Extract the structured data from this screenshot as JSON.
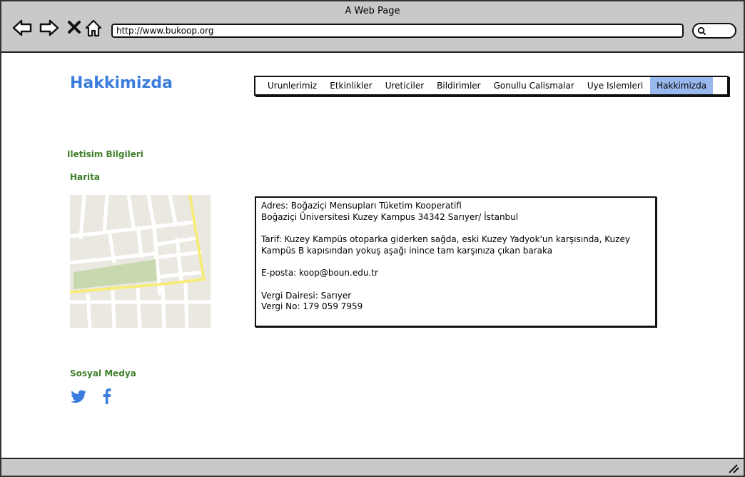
{
  "browser": {
    "window_title": "A Web Page",
    "url": "http://www.bukoop.org"
  },
  "page": {
    "title": "Hakkimizda"
  },
  "nav": {
    "items": [
      "Urunlerimiz",
      "Etkinlikler",
      "Ureticiler",
      "Bildirimler",
      "Gonullu Calismalar",
      "Uye Islemleri",
      "Hakkimizda"
    ],
    "active": "Hakkimizda",
    "active_color": "#99b9ee"
  },
  "sections": {
    "contact": "Iletisim Bilgileri",
    "map": "Harita",
    "social": "Sosyal Medya"
  },
  "info": {
    "address_line1": "Adres: Boğaziçi Mensupları Tüketim Kooperatifi",
    "address_line2": "Boğaziçi Üniversitesi Kuzey Kampus 34342 Sarıyer/ İstanbul",
    "directions_line1": "Tarif: Kuzey Kampüs otoparka giderken sağda, eski Kuzey Yadyok'un karşısında, Kuzey",
    "directions_line2": "Kampüs B kapısından yokuş aşağı inince tam karşınıza çıkan baraka",
    "email": "E-posta: koop@boun.edu.tr",
    "tax_office": "Vergi Dairesi: Sarıyer",
    "tax_no": "Vergi No: 179 059 7959"
  },
  "social": {
    "icons": [
      "twitter-icon",
      "facebook-icon"
    ],
    "color": "#3b7ddd"
  },
  "colors": {
    "title_blue": "#3b7ddd",
    "section_green": "#3f7f2a",
    "chrome_gray": "#c9c9c9"
  }
}
